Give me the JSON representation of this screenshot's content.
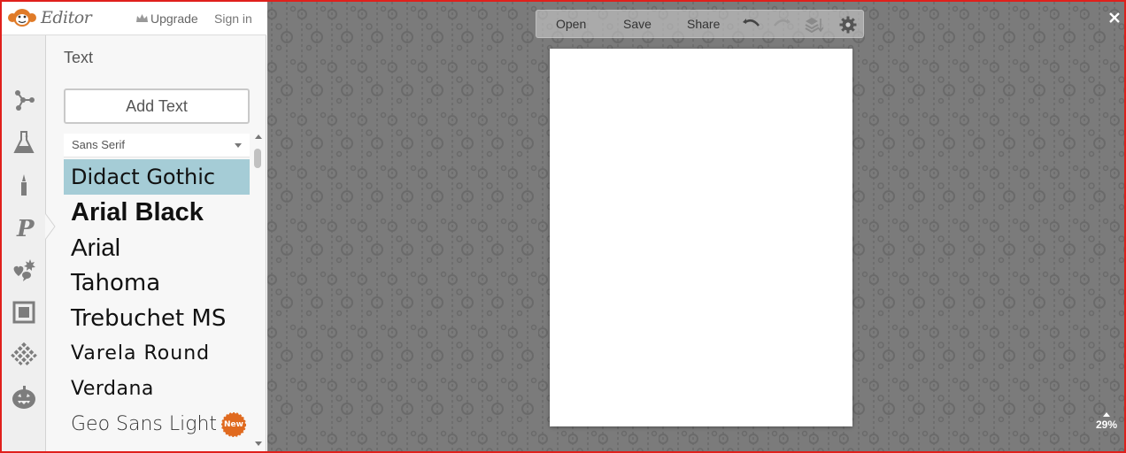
{
  "app": {
    "logo_text": "Editor",
    "upgrade_label": "Upgrade",
    "signin_label": "Sign in"
  },
  "rail": {
    "icons": [
      "effects-icon",
      "touch-up-icon",
      "paint-brush-icon",
      "text-icon",
      "overlays-icon",
      "frames-icon",
      "textures-icon",
      "seasonal-pumpkin-icon"
    ],
    "active": "text-icon"
  },
  "panel": {
    "title": "Text",
    "add_text_label": "Add Text",
    "font_category": "Sans Serif",
    "fonts": [
      {
        "name": "Didact Gothic",
        "selected": true
      },
      {
        "name": "Arial Black",
        "selected": false
      },
      {
        "name": "Arial",
        "selected": false
      },
      {
        "name": "Tahoma",
        "selected": false
      },
      {
        "name": "Trebuchet MS",
        "selected": false
      },
      {
        "name": "Varela Round",
        "selected": false
      },
      {
        "name": "Verdana",
        "selected": false
      },
      {
        "name": "Geo Sans Light",
        "selected": false,
        "badge": "New"
      }
    ],
    "selected_color": "#a5ccd6"
  },
  "toolbar": {
    "open_label": "Open",
    "save_label": "Save",
    "share_label": "Share",
    "icons": [
      "undo-icon",
      "redo-icon",
      "layers-icon",
      "settings-gear-icon"
    ]
  },
  "workspace": {
    "zoom_label": "29%",
    "background_color": "#7b7b7b",
    "close_icon": "close-icon"
  },
  "colors": {
    "brand": "#e07b28",
    "frame_border": "#e0201c",
    "badge": "#e06a1f"
  }
}
